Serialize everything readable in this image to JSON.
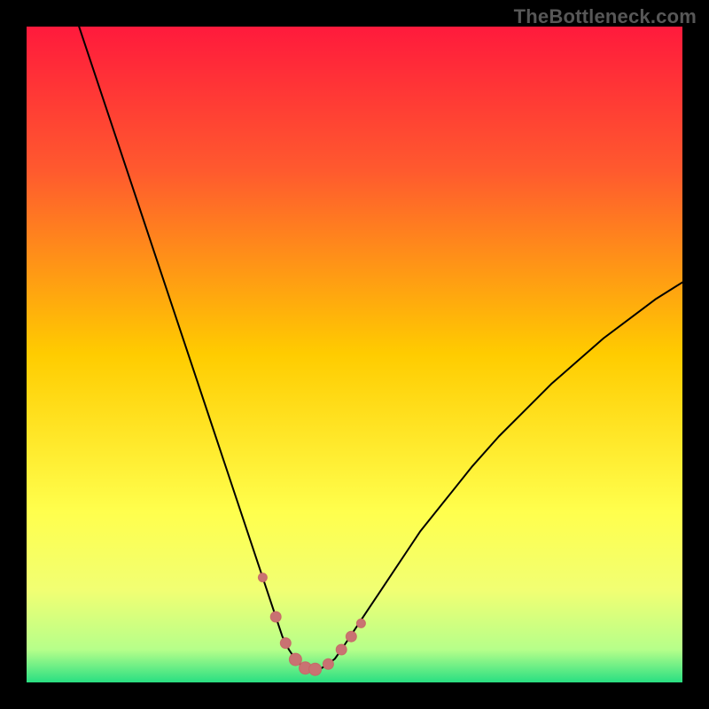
{
  "watermark": "TheBottleneck.com",
  "colors": {
    "frame_background": "#000000",
    "gradient_stops": [
      {
        "offset": "0%",
        "color": "#ff1a3c"
      },
      {
        "offset": "22%",
        "color": "#ff5a2e"
      },
      {
        "offset": "50%",
        "color": "#ffcc00"
      },
      {
        "offset": "74%",
        "color": "#ffff4d"
      },
      {
        "offset": "86%",
        "color": "#f1ff73"
      },
      {
        "offset": "95%",
        "color": "#b6ff8a"
      },
      {
        "offset": "100%",
        "color": "#29df82"
      }
    ],
    "curve_stroke": "#000000",
    "marker_fill": "#c97272"
  },
  "chart_data": {
    "type": "line",
    "title": "",
    "xlabel": "",
    "ylabel": "",
    "xlim": [
      0,
      100
    ],
    "ylim": [
      0,
      100
    ],
    "grid": false,
    "legend": false,
    "series": [
      {
        "name": "bottleneck-curve",
        "x": [
          8,
          10,
          12,
          14,
          16,
          18,
          20,
          22,
          24,
          26,
          28,
          30,
          32,
          34,
          36,
          37,
          38,
          39,
          40,
          41,
          42,
          43,
          44,
          45,
          46,
          47,
          48,
          50,
          52,
          54,
          56,
          58,
          60,
          64,
          68,
          72,
          76,
          80,
          84,
          88,
          92,
          96,
          100
        ],
        "y": [
          100,
          94,
          88,
          82,
          76,
          70,
          64,
          58,
          52,
          46,
          40,
          34,
          28,
          22,
          16,
          13,
          10,
          7,
          5,
          3.5,
          2.5,
          2,
          2,
          2.2,
          2.8,
          3.6,
          5,
          8,
          11,
          14,
          17,
          20,
          23,
          28,
          33,
          37.5,
          41.5,
          45.5,
          49,
          52.5,
          55.5,
          58.5,
          61
        ]
      }
    ],
    "markers": {
      "name": "highlight-points",
      "x": [
        36,
        38,
        39.5,
        41,
        42.5,
        44,
        46,
        48,
        49.5,
        51
      ],
      "y": [
        16,
        10,
        6,
        3.5,
        2.2,
        2,
        2.8,
        5,
        7,
        9
      ],
      "r": [
        5,
        6,
        6,
        7,
        7,
        7,
        6,
        6,
        6,
        5
      ]
    }
  }
}
